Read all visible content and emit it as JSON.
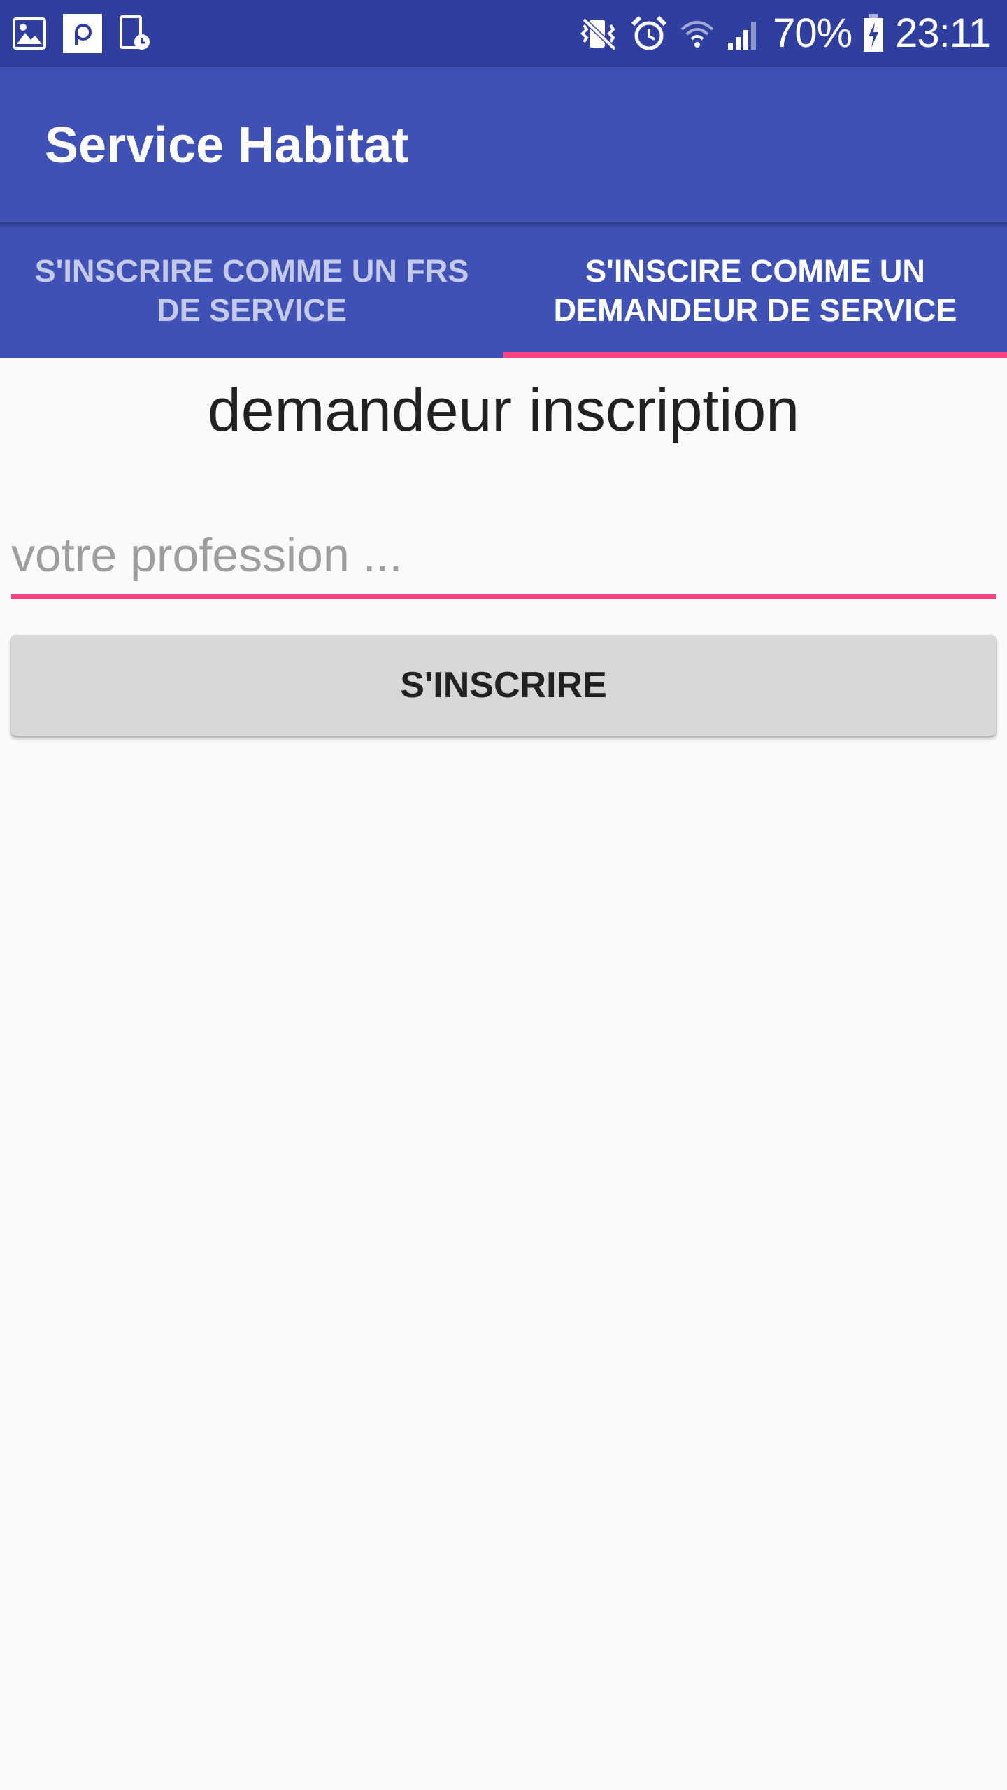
{
  "status_bar": {
    "left_icons": [
      "gallery-icon",
      "app-notification-icon",
      "screenshot-icon"
    ],
    "right_icons": [
      "vibrate-mute-icon",
      "alarm-icon",
      "wifi-icon",
      "signal-icon",
      "battery-charging-icon"
    ],
    "battery_percent": "70%",
    "time": "23:11"
  },
  "app_bar": {
    "title": "Service Habitat"
  },
  "tabs": [
    {
      "label": "S'INSCRIRE COMME UN FRS DE SERVICE",
      "active": false
    },
    {
      "label": "S'INSCIRE COMME UN DEMANDEUR DE SERVICE",
      "active": true
    }
  ],
  "form": {
    "heading": "demandeur inscription",
    "profession_placeholder": "votre profession ...",
    "profession_value": "",
    "submit_label": "S'INSCRIRE"
  },
  "colors": {
    "status_bar": "#303f9f",
    "primary": "#3f51b5",
    "accent": "#ff4081",
    "background": "#fafafa",
    "button": "#d6d7d7",
    "inactive_tab_text": "#c5cae9"
  }
}
